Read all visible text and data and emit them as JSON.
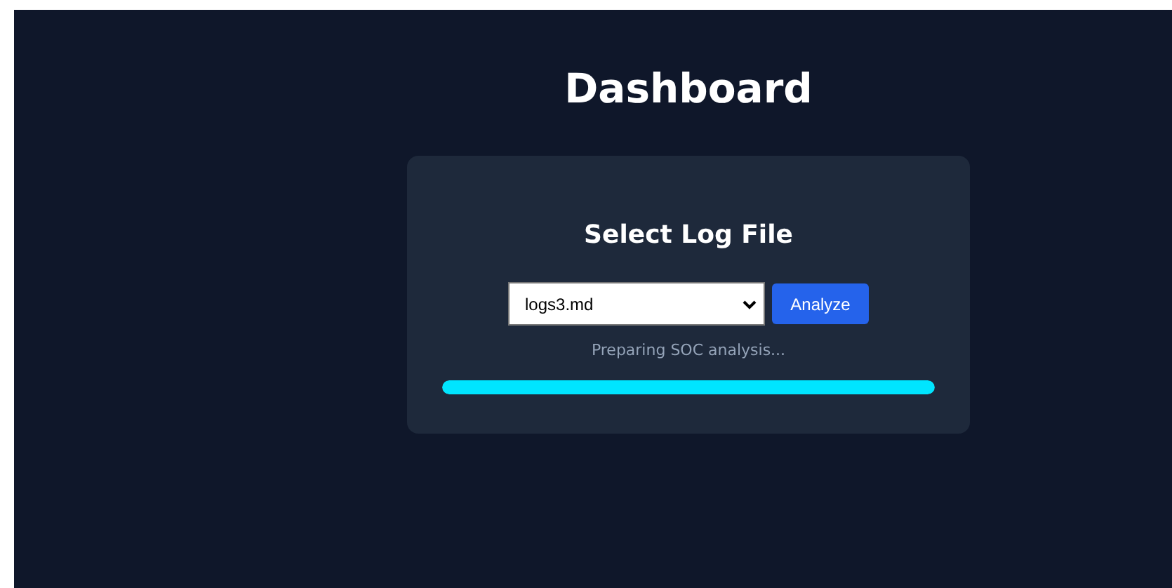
{
  "title": "Dashboard",
  "card": {
    "heading": "Select Log File",
    "select": {
      "value": "logs3.md"
    },
    "button": "Analyze",
    "status": "Preparing SOC analysis...",
    "progress": {
      "level": 1
    }
  }
}
